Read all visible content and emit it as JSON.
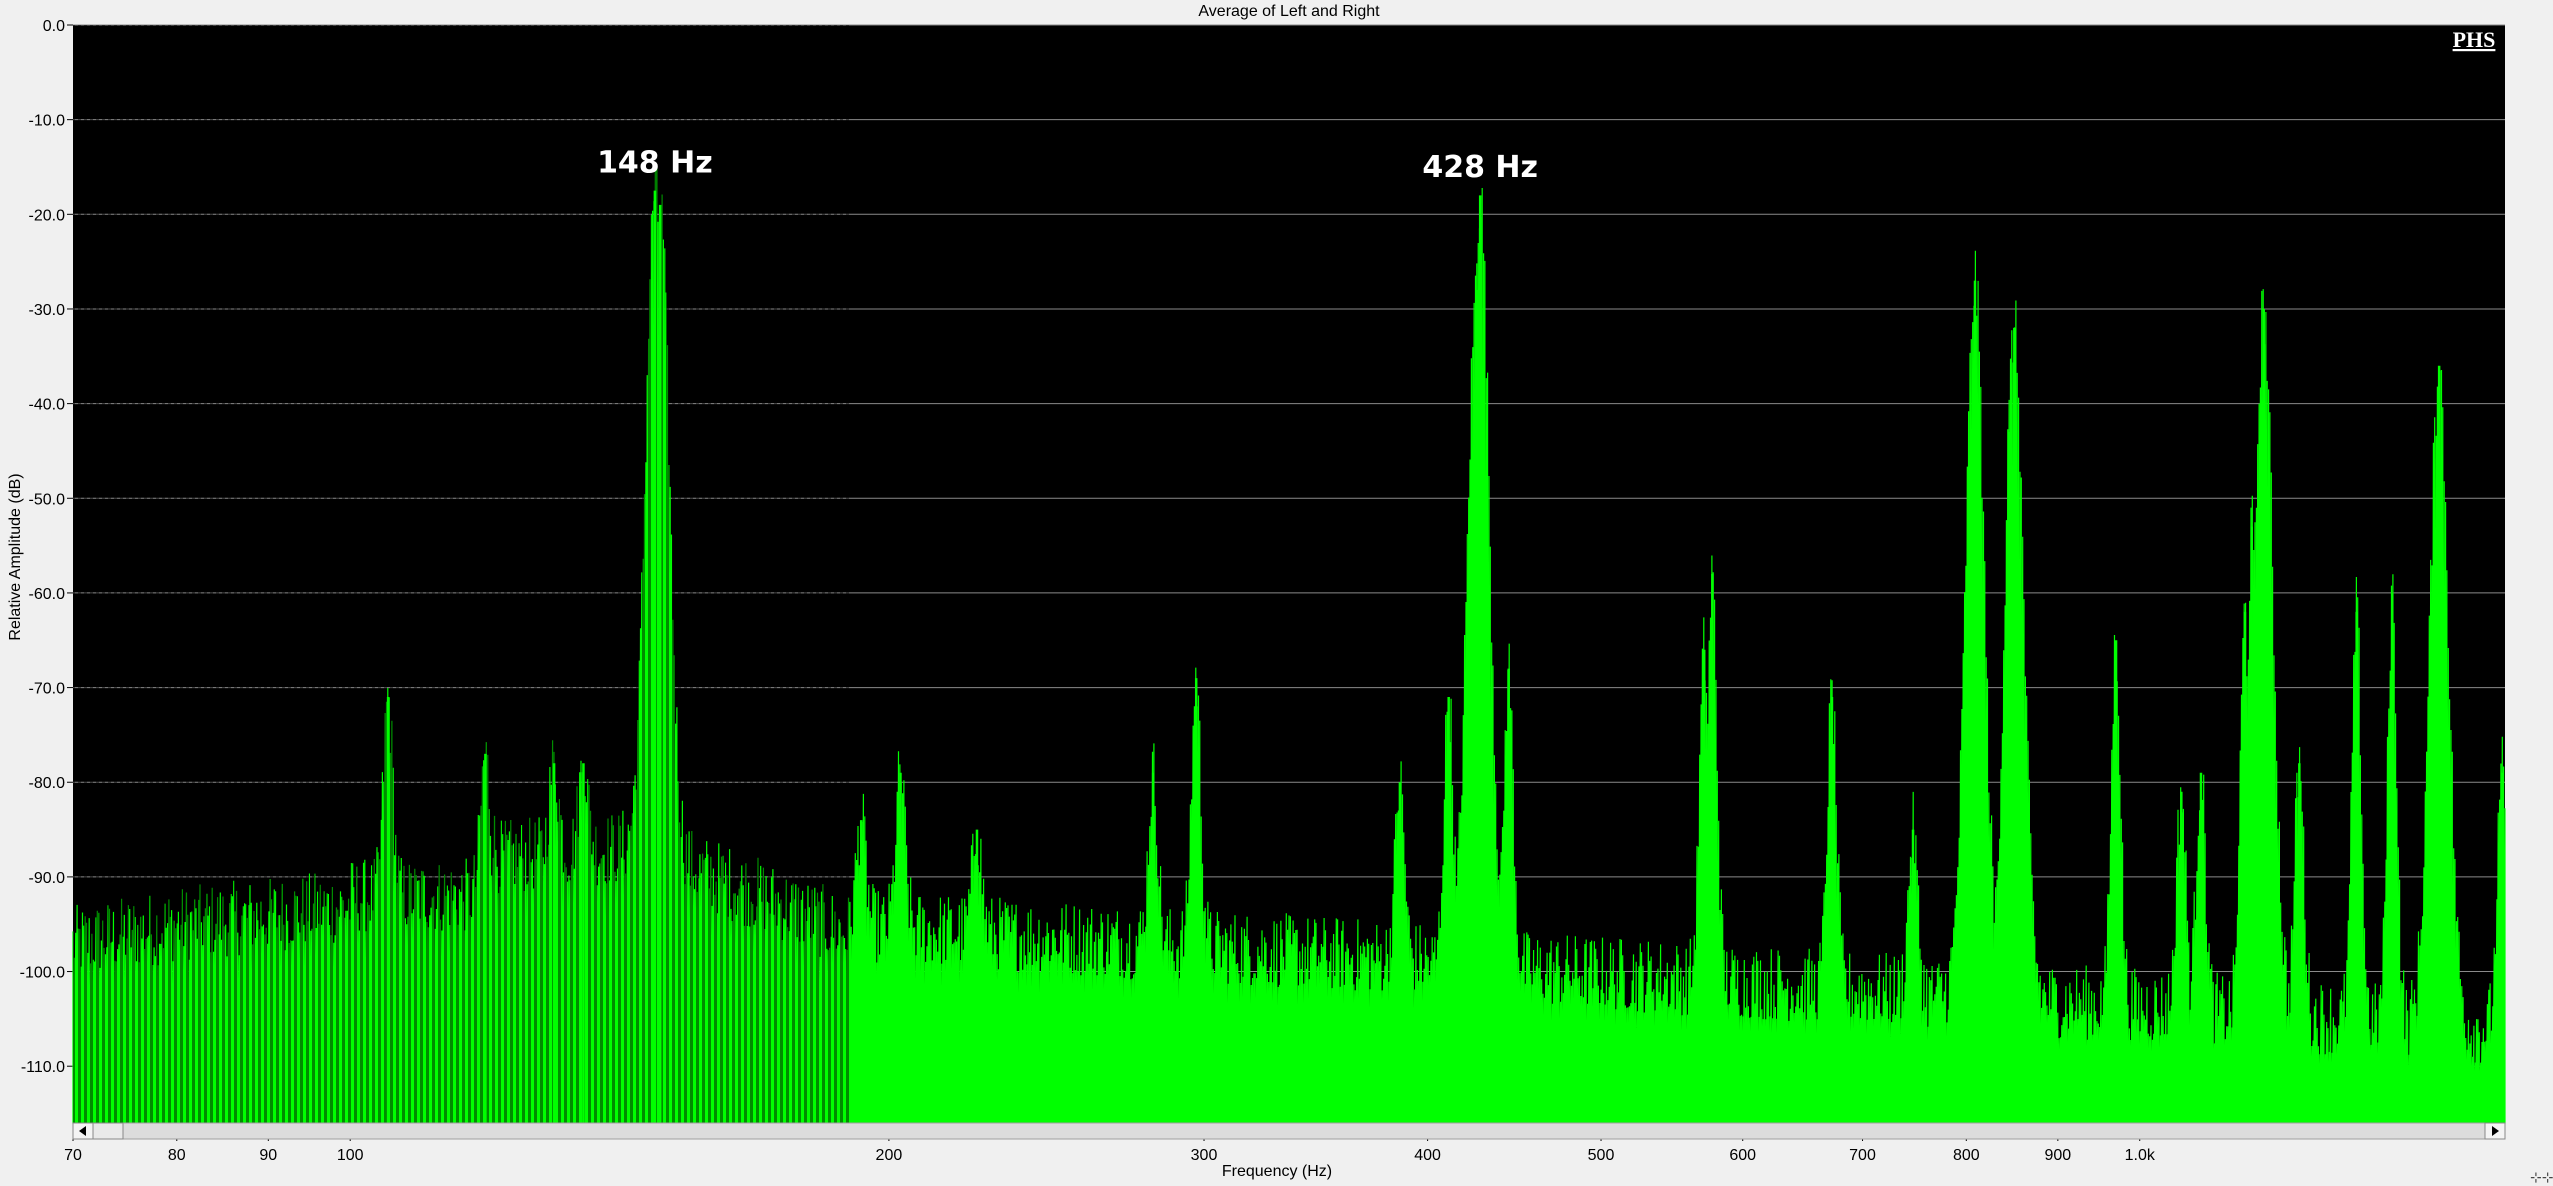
{
  "chart_data": {
    "type": "area",
    "title": "Average of Left and Right",
    "xlabel": "Frequency (Hz)",
    "ylabel": "Relative Amplitude (dB)",
    "x_scale": "log",
    "xlim": [
      70,
      1600
    ],
    "ylim": [
      -116,
      0
    ],
    "grid": true,
    "y_ticks": [
      "0.0",
      "-10.0",
      "-20.0",
      "-30.0",
      "-40.0",
      "-50.0",
      "-60.0",
      "-70.0",
      "-80.0",
      "-90.0",
      "-100.0",
      "-110.0"
    ],
    "x_ticks": [
      {
        "value": 70,
        "label": "70"
      },
      {
        "value": 80,
        "label": "80"
      },
      {
        "value": 90,
        "label": "90"
      },
      {
        "value": 100,
        "label": "100"
      },
      {
        "value": 200,
        "label": "200"
      },
      {
        "value": 300,
        "label": "300"
      },
      {
        "value": 400,
        "label": "400"
      },
      {
        "value": 500,
        "label": "500"
      },
      {
        "value": 600,
        "label": "600"
      },
      {
        "value": 700,
        "label": "700"
      },
      {
        "value": 800,
        "label": "800"
      },
      {
        "value": 900,
        "label": "900"
      },
      {
        "value": 1000,
        "label": "1.0k"
      }
    ],
    "series": [
      {
        "color": "#00ff00",
        "peaks": [
          {
            "x": 105,
            "y": -71
          },
          {
            "x": 119,
            "y": -77
          },
          {
            "x": 130,
            "y": -78
          },
          {
            "x": 135,
            "y": -78
          },
          {
            "x": 148,
            "y": -17.5
          },
          {
            "x": 149,
            "y": -19
          },
          {
            "x": 193,
            "y": -84
          },
          {
            "x": 203,
            "y": -79
          },
          {
            "x": 224,
            "y": -85
          },
          {
            "x": 281,
            "y": -79
          },
          {
            "x": 297,
            "y": -69
          },
          {
            "x": 386,
            "y": -80
          },
          {
            "x": 411,
            "y": -71
          },
          {
            "x": 426,
            "y": -28
          },
          {
            "x": 428,
            "y": -18
          },
          {
            "x": 444,
            "y": -68
          },
          {
            "x": 571,
            "y": -66
          },
          {
            "x": 577,
            "y": -58
          },
          {
            "x": 673,
            "y": -71
          },
          {
            "x": 747,
            "y": -85
          },
          {
            "x": 809,
            "y": -27
          },
          {
            "x": 845,
            "y": -43
          },
          {
            "x": 851,
            "y": -32
          },
          {
            "x": 970,
            "y": -65
          },
          {
            "x": 1055,
            "y": -81
          },
          {
            "x": 1082,
            "y": -79
          },
          {
            "x": 1145,
            "y": -62
          },
          {
            "x": 1155,
            "y": -53
          },
          {
            "x": 1173,
            "y": -30
          },
          {
            "x": 1228,
            "y": -78
          },
          {
            "x": 1322,
            "y": -62
          },
          {
            "x": 1384,
            "y": -60
          },
          {
            "x": 1470,
            "y": -36
          },
          {
            "x": 1594,
            "y": -79
          }
        ]
      }
    ],
    "annotations": [
      {
        "text": "148 Hz",
        "x": 148,
        "y": -16
      },
      {
        "text": "428 Hz",
        "x": 428,
        "y": -16.5
      }
    ]
  },
  "logo": "PHS",
  "colors": {
    "plot_background": "#000000",
    "trace": "#00ff00",
    "trace_dark": "#00b400",
    "gridline": "#8a8a8a"
  }
}
